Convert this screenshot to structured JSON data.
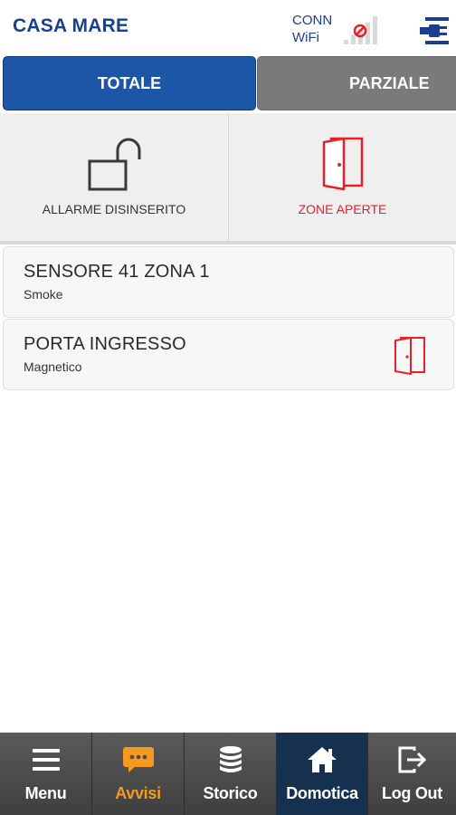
{
  "header": {
    "title": "CASA MARE",
    "conn_line1": "CONN",
    "conn_line2": "WiFi",
    "icons": [
      "signal-bars-icon",
      "no-connection-icon",
      "plug-icon"
    ]
  },
  "tabs": [
    {
      "label": "TOTALE",
      "active": true
    },
    {
      "label": "PARZIALE",
      "active": false
    }
  ],
  "status": {
    "alarm_label": "ALLARME DISINSERITO",
    "zones_label": "ZONE APERTE"
  },
  "sensors": [
    {
      "name": "SENSORE 41 ZONA 1",
      "type": "Smoke",
      "open_door_icon": false
    },
    {
      "name": "PORTA INGRESSO",
      "type": "Magnetico",
      "open_door_icon": true
    }
  ],
  "nav": [
    {
      "label": "Menu",
      "icon": "hamburger-menu-icon"
    },
    {
      "label": "Avvisi",
      "icon": "chat-bubble-icon"
    },
    {
      "label": "Storico",
      "icon": "database-icon"
    },
    {
      "label": "Domotica",
      "icon": "home-icon"
    },
    {
      "label": "Log Out",
      "icon": "logout-icon"
    }
  ],
  "colors": {
    "brand_blue": "#1a3f8f",
    "tab_active": "#1d56a6",
    "tab_inactive": "#7a7a7a",
    "alert_red": "#e8202a",
    "avvisi_orange": "#f39a1f",
    "nav_active": "#15314f"
  }
}
